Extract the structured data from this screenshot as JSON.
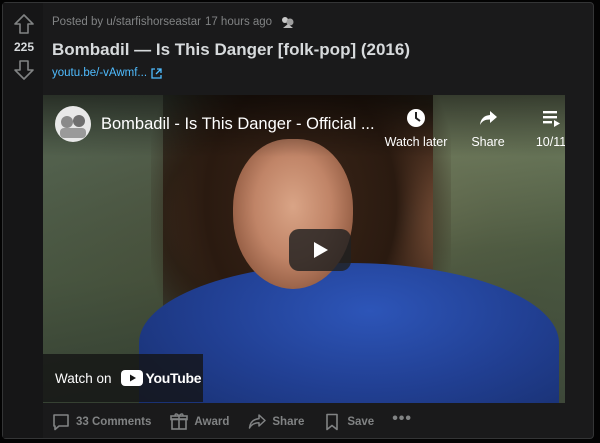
{
  "vote": {
    "count": "225"
  },
  "meta": {
    "posted_by": "Posted by u/starfishorseastar",
    "time": "17 hours ago"
  },
  "post": {
    "title": "Bombadil — Is This Danger [folk-pop] (2016)",
    "link_text": "youtu.be/-vAwmf..."
  },
  "video": {
    "title": "Bombadil - Is This Danger - Official ...",
    "watch_later": "Watch later",
    "share": "Share",
    "playlist_position": "10/11",
    "watch_on": "Watch on",
    "youtube_wordmark": "YouTube"
  },
  "actions": {
    "comments": "33 Comments",
    "award": "Award",
    "share": "Share",
    "save": "Save",
    "more": "•••"
  },
  "colors": {
    "card_bg": "#1a1a1b",
    "link": "#4fbcff",
    "muted": "#818384",
    "text": "#d7dadc",
    "youtube_red": "#ff0000"
  },
  "icons": [
    "upvote-icon",
    "downvote-icon",
    "award-badge-icon",
    "external-link-icon",
    "clock-icon",
    "share-arrow-icon",
    "playlist-icon",
    "play-icon",
    "youtube-logo-icon",
    "comment-icon",
    "gift-icon",
    "share-icon",
    "bookmark-icon"
  ]
}
